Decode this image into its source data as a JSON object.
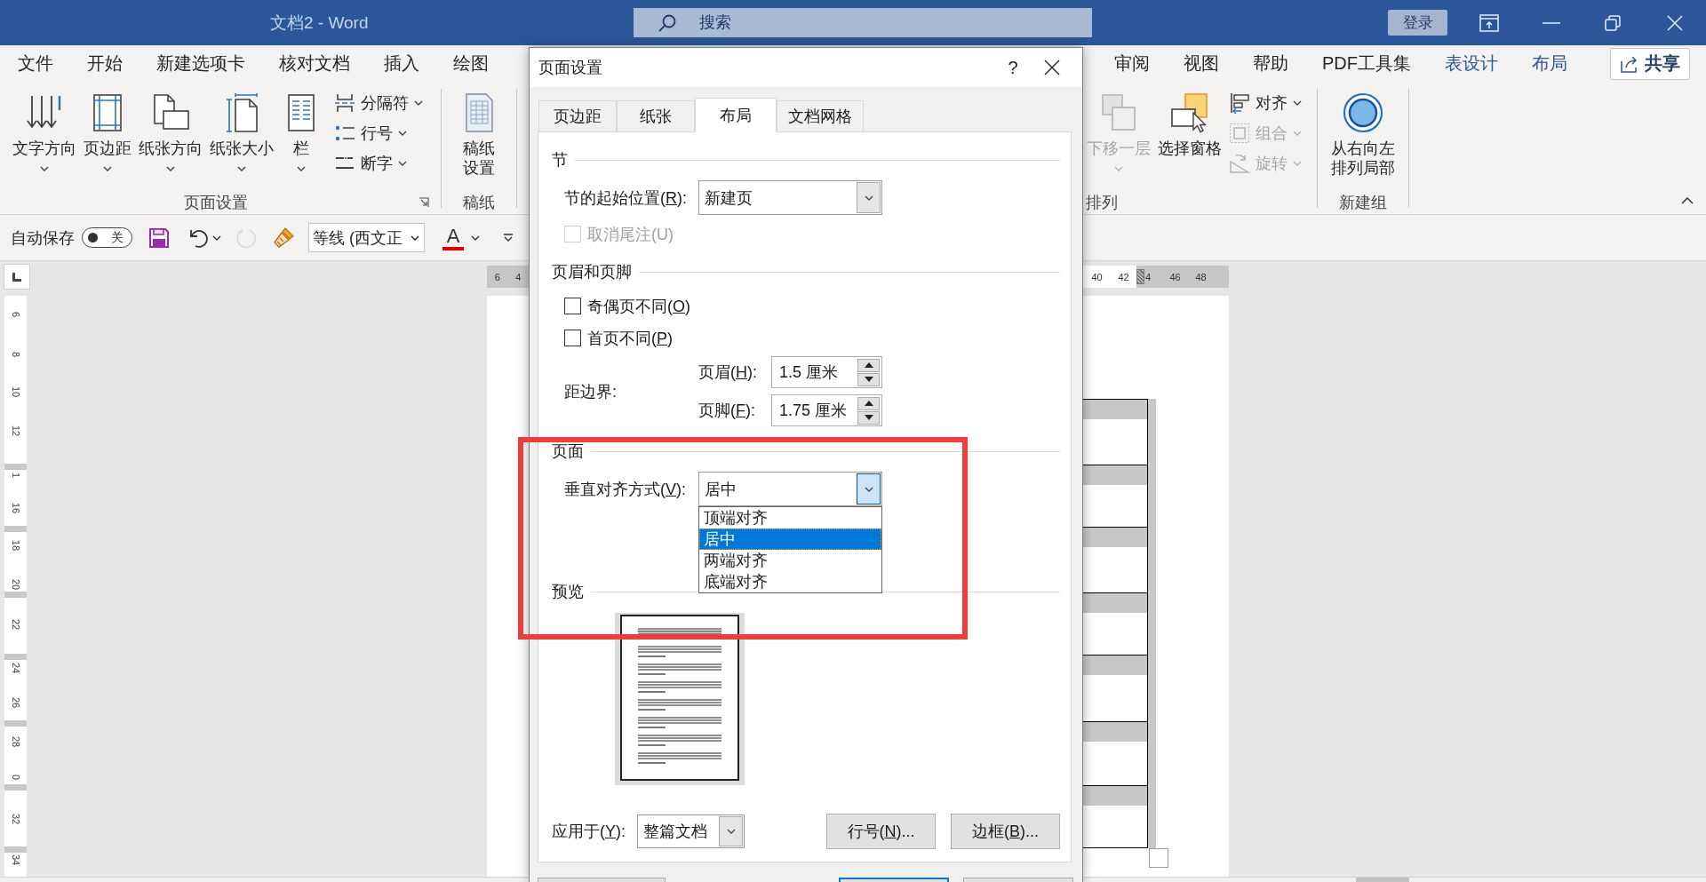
{
  "window": {
    "title": "文档2 - Word",
    "search": {
      "placeholder": "搜索"
    },
    "sign_in": "登录"
  },
  "ribbon_tabs": {
    "left": [
      {
        "label": "文件",
        "contextual": false
      },
      {
        "label": "开始",
        "contextual": false
      },
      {
        "label": "新建选项卡",
        "contextual": false
      },
      {
        "label": "核对文档",
        "contextual": false
      },
      {
        "label": "插入",
        "contextual": false
      },
      {
        "label": "绘图",
        "contextual": false
      }
    ],
    "right": [
      {
        "label": "审阅",
        "contextual": false
      },
      {
        "label": "视图",
        "contextual": false
      },
      {
        "label": "帮助",
        "contextual": false
      },
      {
        "label": "PDF工具集",
        "contextual": false
      },
      {
        "label": "表设计",
        "contextual": true
      },
      {
        "label": "布局",
        "contextual": true
      }
    ]
  },
  "share": "共享",
  "ribbon": {
    "left_groups": [
      {
        "label": "页面设置",
        "launcher": true,
        "large": [
          {
            "label": "文字方向",
            "dropdown": true,
            "disabled": false
          },
          {
            "label": "页边距",
            "dropdown": true,
            "disabled": false
          },
          {
            "label": "纸张方向",
            "dropdown": true,
            "disabled": false
          },
          {
            "label": "纸张大小",
            "dropdown": true,
            "disabled": false
          },
          {
            "label": "栏",
            "dropdown": true,
            "disabled": false
          }
        ],
        "small": [
          {
            "label": "分隔符",
            "dropdown": true,
            "disabled": false
          },
          {
            "label": "行号",
            "dropdown": true,
            "disabled": false
          },
          {
            "label": "断字",
            "dropdown": true,
            "disabled": false
          }
        ]
      },
      {
        "label": "稿纸",
        "large": [
          {
            "label": "稿纸设置",
            "dropdown": false,
            "disabled": false
          }
        ]
      }
    ],
    "right_groups": [
      {
        "label": "排列",
        "large": [
          {
            "label": "下移一层",
            "dropdown": true,
            "disabled": true
          },
          {
            "label": "选择窗格",
            "dropdown": false,
            "disabled": false
          }
        ],
        "small": [
          {
            "label": "对齐",
            "dropdown": true,
            "disabled": false
          },
          {
            "label": "组合",
            "dropdown": true,
            "disabled": true
          },
          {
            "label": "旋转",
            "dropdown": true,
            "disabled": true
          }
        ]
      },
      {
        "label": "新建组",
        "large": [
          {
            "label": "从右向左排列局部",
            "dropdown": false,
            "disabled": false
          }
        ]
      }
    ]
  },
  "quick_access": [
    {
      "kind": "autosave",
      "label": "自动保存",
      "on": false,
      "state": "关",
      "disabled": false,
      "dropdown": false
    },
    {
      "kind": "save",
      "disabled": false,
      "dropdown": false
    },
    {
      "kind": "undo",
      "disabled": false,
      "dropdown": true
    },
    {
      "kind": "redo",
      "disabled": true,
      "dropdown": false
    },
    {
      "kind": "format-painter",
      "disabled": false,
      "dropdown": false
    },
    {
      "kind": "font",
      "value": "等线 (西文正",
      "disabled": false,
      "dropdown": true
    },
    {
      "kind": "font-color",
      "glyph": "A",
      "disabled": false,
      "dropdown": true
    },
    {
      "kind": "customize",
      "disabled": false,
      "dropdown": false
    }
  ],
  "document": {
    "horizontal_ruler": {
      "left": [
        {
          "label": "6",
          "margin": true,
          "marker": false
        },
        {
          "label": "4",
          "margin": true,
          "marker": false
        }
      ],
      "right": [
        {
          "label": "40",
          "margin": false,
          "marker": false
        },
        {
          "label": "42",
          "margin": false,
          "marker": false
        },
        {
          "label": "4",
          "margin": true,
          "marker": true
        },
        {
          "label": "46",
          "margin": true,
          "marker": false
        },
        {
          "label": "48",
          "margin": true,
          "marker": false
        }
      ]
    },
    "vertical_ruler": [
      "6",
      "8",
      "10",
      "12",
      "1",
      "16",
      "18",
      "20",
      "22",
      "24",
      "26",
      "28",
      "0",
      "32",
      "34"
    ],
    "table_rows": [
      {
        "shaded": true
      },
      {
        "shaded": true
      },
      {
        "shaded": true
      },
      {
        "shaded": true
      },
      {
        "shaded": true
      },
      {
        "shaded": true
      },
      {
        "shaded": true
      }
    ]
  },
  "dialog": {
    "title": "页面设置",
    "help": "?",
    "tabs": [
      {
        "label": "页边距",
        "selected": false
      },
      {
        "label": "纸张",
        "selected": false
      },
      {
        "label": "布局",
        "selected": true
      },
      {
        "label": "文档网格",
        "selected": false
      }
    ],
    "sections": [
      {
        "title": "节",
        "items": [
          {
            "kind": "select",
            "label": {
              "pre": "节的起始位置(",
              "key": "R",
              "post": "):"
            },
            "value": "新建页",
            "open": false
          },
          {
            "kind": "checkbox",
            "label": {
              "pre": "取消尾注(U)"
            },
            "checked": false,
            "disabled": true
          }
        ]
      },
      {
        "title": "页眉和页脚",
        "items": [
          {
            "kind": "checkbox",
            "label": {
              "pre": "奇偶页不同(",
              "key": "O",
              "post": ")"
            },
            "checked": false,
            "disabled": false
          },
          {
            "kind": "checkbox",
            "label": {
              "pre": "首页不同(",
              "key": "P",
              "post": ")"
            },
            "checked": false,
            "disabled": false
          },
          {
            "kind": "spin-group",
            "label": {
              "pre": "距边界:"
            },
            "fields": [
              {
                "label": {
                  "pre": "页眉(",
                  "key": "H",
                  "post": "):"
                },
                "value": "1.5 厘米"
              },
              {
                "label": {
                  "pre": "页脚(",
                  "key": "F",
                  "post": "):"
                },
                "value": "1.75 厘米"
              }
            ]
          }
        ]
      },
      {
        "title": "页面",
        "items": [
          {
            "kind": "select",
            "label": {
              "pre": "垂直对齐方式(",
              "key": "V",
              "post": "):"
            },
            "value": "居中",
            "open": true,
            "options": [
              {
                "label": "顶端对齐",
                "selected": false
              },
              {
                "label": "居中",
                "selected": true
              },
              {
                "label": "两端对齐",
                "selected": false
              },
              {
                "label": "底端对齐",
                "selected": false
              }
            ]
          }
        ]
      },
      {
        "title": "预览",
        "items": [
          {
            "kind": "preview"
          }
        ]
      }
    ],
    "apply_to": {
      "label": {
        "pre": "应用于(",
        "key": "Y",
        "post": "):"
      },
      "value": "整篇文档",
      "open": false
    },
    "buttons": [
      {
        "label": {
          "pre": "行号(",
          "key": "N",
          "post": ")..."
        }
      },
      {
        "label": {
          "pre": "边框(",
          "key": "B",
          "post": ")..."
        }
      }
    ],
    "footer_buttons": [
      {
        "default": false
      },
      {
        "default": true
      },
      {
        "default": false
      }
    ]
  },
  "annotation": {
    "kind": "rectangle"
  }
}
